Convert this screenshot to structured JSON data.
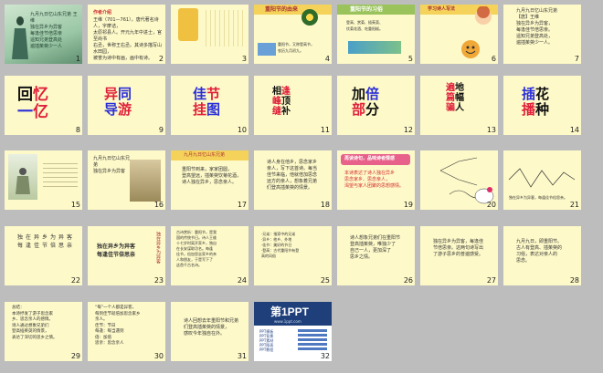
{
  "slides": [
    {
      "num": "1"
    },
    {
      "num": "2",
      "lines": [
        "作者介绍",
        "王维（701—761），唐代著名诗人，字摩诘，",
        "太原祁县人。开元九年中进士，官至尚书",
        "右丞，世称王右丞。其诗多描写山水田园，",
        "被誉为诗中有画，画中有诗。"
      ]
    },
    {
      "num": "3"
    },
    {
      "num": "4",
      "title": "重阳节的由来",
      "caption": [
        "重阳节，又称登高节，",
        "农历九月初九。"
      ]
    },
    {
      "num": "5",
      "title": "重阳节的习俗",
      "caption": [
        "登高、赏菊、插茱萸、",
        "饮菊花酒、吃重阳糕。"
      ]
    },
    {
      "num": "6",
      "title": "学习诗人写法"
    },
    {
      "num": "7",
      "lines": [
        "九月九日忆山东兄弟",
        "【唐】王维",
        "独在异乡为异客，",
        "每逢佳节倍思亲。",
        "遥知兄弟登高处，",
        "遍插茱萸少一人。"
      ]
    },
    {
      "num": "8",
      "w": [
        {
          "t": "回",
          "c": "k"
        },
        {
          "t": "忆",
          "c": "r"
        },
        {
          "t": "一",
          "c": "b"
        },
        {
          "t": "亿",
          "c": "r"
        }
      ]
    },
    {
      "num": "9",
      "w": [
        {
          "t": "异",
          "c": "r"
        },
        {
          "t": "同",
          "c": "b"
        },
        {
          "t": "导",
          "c": "b"
        },
        {
          "t": "游",
          "c": "r"
        }
      ]
    },
    {
      "num": "10",
      "w": [
        {
          "t": "佳",
          "c": "b"
        },
        {
          "t": "节",
          "c": "r"
        },
        {
          "t": "挂",
          "c": "r"
        },
        {
          "t": "图",
          "c": "b"
        }
      ]
    },
    {
      "num": "11",
      "w": [
        {
          "t": "相",
          "c": "k"
        },
        {
          "t": "逢",
          "c": "r"
        },
        {
          "t": "峰",
          "c": "r"
        },
        {
          "t": "顶",
          "c": "k"
        },
        {
          "t": "缝",
          "c": "r"
        },
        {
          "t": "补",
          "c": "k"
        }
      ]
    },
    {
      "num": "12",
      "w": [
        {
          "t": "加",
          "c": "k"
        },
        {
          "t": "倍",
          "c": "b"
        },
        {
          "t": "部",
          "c": "r"
        },
        {
          "t": "分",
          "c": "k"
        }
      ]
    },
    {
      "num": "13",
      "w": [
        {
          "t": "遍",
          "c": "r"
        },
        {
          "t": "地",
          "c": "k"
        },
        {
          "t": "篇",
          "c": "r"
        },
        {
          "t": "幅",
          "c": "k"
        },
        {
          "t": "骗",
          "c": "r"
        },
        {
          "t": "人",
          "c": "k"
        }
      ]
    },
    {
      "num": "14",
      "w": [
        {
          "t": "插",
          "c": "b"
        },
        {
          "t": "花",
          "c": "k"
        },
        {
          "t": "播",
          "c": "r"
        },
        {
          "t": "种",
          "c": "k"
        }
      ]
    },
    {
      "num": "15"
    },
    {
      "num": "16",
      "lines": [
        "九月九日忆山东兄弟",
        "独在异乡为异客"
      ]
    },
    {
      "num": "17",
      "lines": [
        "九月九日忆山东兄弟",
        "重阳节到来，家家团圆，",
        "登高望远，插茱萸饮菊花酒，",
        "诗人独在异乡，思念亲人。"
      ]
    },
    {
      "num": "18",
      "lines": [
        "诗人身在他乡，思念家乡",
        "亲人，写下这首诗。每当",
        "佳节来临，他就倍加思念",
        "远方的亲人，想象着兄弟",
        "们登高插茱萸的情景。"
      ]
    },
    {
      "num": "19",
      "head": "再读诗句，品味诗者情感",
      "lines": [
        "本诗表达了诗人独在异乡",
        "思念家乡、思念亲人，",
        "渴望与家人团聚的思想感情。"
      ]
    },
    {
      "num": "20"
    },
    {
      "num": "21",
      "lines": [
        "独在异乡为异客，每逢佳节倍思亲。"
      ]
    },
    {
      "num": "22",
      "lines": [
        "独在异乡为异客",
        "每逢佳节倍思亲"
      ]
    },
    {
      "num": "23",
      "vert": [
        "独在异乡为异客",
        "每逢佳节倍思亲"
      ]
    },
    {
      "num": "24",
      "lines": [
        "古诗赏析：重阳节，是我",
        "国的传统节日。诗人王维",
        "十七岁时离开家乡，独自",
        "在长安谋取功名。每逢",
        "佳节，倍加思念家乡的亲",
        "人和朋友，于是写下了",
        "这首千古名诗。"
      ]
    },
    {
      "num": "25",
      "lines": [
        "·兄弟：指家中的兄弟",
        "·异乡：他乡、外地",
        "·佳节：美好的节日",
        "·登高：古代重阳节有登",
        "  高的风俗"
      ]
    },
    {
      "num": "26",
      "lines": [
        "诗人想象兄弟们在重阳节",
        "登高插茱萸，唯独少了",
        "自己一人，更加深了",
        "思乡之情。"
      ]
    },
    {
      "num": "27",
      "lines": [
        "独在异乡为异客，每逢佳",
        "节倍思亲。这两句诗写出",
        "了游子思乡的普遍感受。"
      ]
    },
    {
      "num": "28",
      "lines": [
        "九月九日，即重阳节。",
        "古人有登高、插茱萸的",
        "习俗，表达对亲人的",
        "思念。"
      ]
    },
    {
      "num": "29",
      "lines": [
        "总结：",
        "本诗抒发了游子思念家",
        "乡、思念亲人的感情。",
        "诗人通过想象兄弟们",
        "登高插茱萸的情景，",
        "表达了深切的思乡之情。"
      ]
    },
    {
      "num": "30",
      "lines": [
        "“每”一个人都是异客，",
        "每到佳节就倍加思念家乡",
        "亲人。",
        "佳节：节日",
        "每逢：每当遇到",
        "倍：加倍",
        "思亲：思念亲人"
      ]
    },
    {
      "num": "31",
      "lines": [
        "诗人回想去年重阳节和兄弟",
        "们登高插茱萸的情景，",
        "感叹今年独自在外。"
      ]
    },
    {
      "num": "32",
      "brand": "第1PPT",
      "sub": "www.1ppt.com",
      "mini": [
        "PPT模板",
        "PPT背景",
        "PPT素材",
        "PPT图表",
        "PPT教程"
      ]
    }
  ]
}
